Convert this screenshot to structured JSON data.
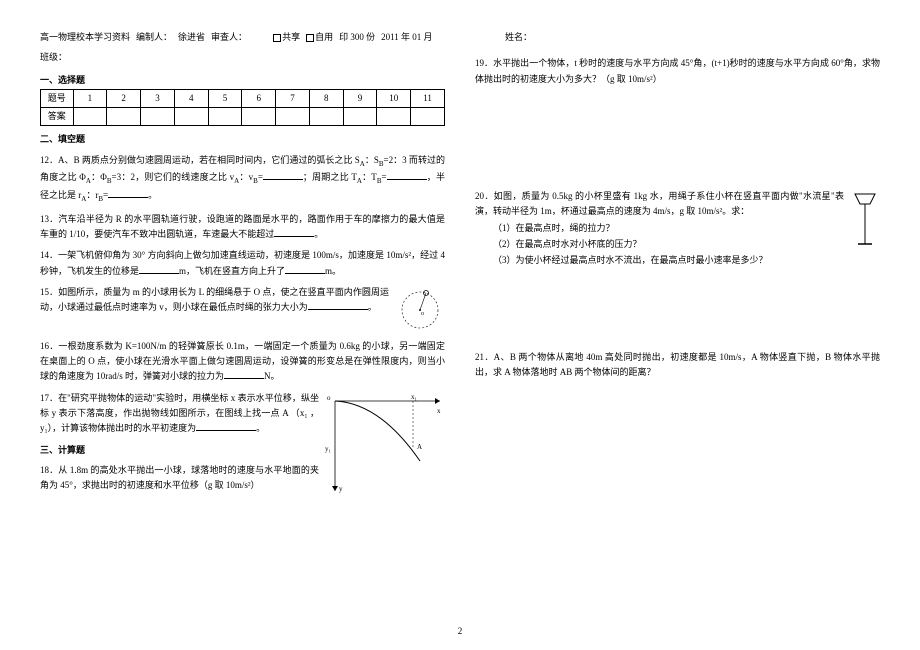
{
  "header": {
    "title": "高一物理校本学习资料",
    "author_label": "编制人：",
    "author": "徐进省",
    "reviewer_label": "审查人：",
    "share": "共享",
    "self": "自用",
    "print": "印 300 份",
    "date": "2011 年 01 月",
    "class_label": "班级：",
    "name_label": "姓名："
  },
  "section1": {
    "title": "一、选择题",
    "row1_label": "题号",
    "cols": [
      "1",
      "2",
      "3",
      "4",
      "5",
      "6",
      "7",
      "8",
      "9",
      "10",
      "11"
    ],
    "row2_label": "答案"
  },
  "section2_title": "二、填空题",
  "q12": "12．A、B 两质点分别做匀速圆周运动，若在相同时间内，它们通过的弧长之比 S",
  "q12b": "=2：3 而转过的角度之比 Φ",
  "q12c": "=3：2，则它们的线速度之比 v",
  "q12d": "；周期之比 T",
  "q12e": "，半径之比是 r",
  "q12f": "。",
  "q13": "13．汽车沿半径为 R 的水平圆轨道行驶，设跑道的路面是水平的，路面作用于车的摩擦力的最大值是车重的 1/10，要使汽车不致冲出圆轨道，车速最大不能超过",
  "q13b": "。",
  "q14": "14．一架飞机俯仰角为 30° 方向斜向上做匀加速直线运动，初速度是 100m/s，加速度是 10m/s²，经过 4 秒钟，飞机发生的位移是",
  "q14b": "m，飞机在竖直方向上升了",
  "q14c": "m。",
  "q15": "15．如图所示，质量为 m 的小球用长为 L 的细绳悬于 O 点，使之在竖直平面内作圆周运动，小球通过最低点时速率为 v，则小球在最低点时绳的张力大小为",
  "q15b": "。",
  "q16": "16．一根劲度系数为 K=100N/m 的轻弹簧原长 0.1m，一端固定一个质量为 0.6kg 的小球，另一端固定在桌面上的 O 点，使小球在光滑水平面上做匀速圆周运动，设弹簧的形变总是在弹性限度内，则当小球的角速度为 10rad/s 时，弹簧对小球的拉力为",
  "q16b": "N。",
  "q17": "17．在\"研究平抛物体的运动\"实验时，用横坐标 x 表示水平位移，纵坐标 y 表示下落高度，作出抛物线如图所示，在图线上找一点 A （x₁ ，y₁），计算该物体抛出时的水平初速度为",
  "q17b": "。",
  "section3_title": "三、计算题",
  "q18": "18．从 1.8m 的高处水平抛出一小球，球落地时的速度与水平地面的夹角为 45°，求抛出时的初速度和水平位移（g 取 10m/s²）",
  "q19": "19．水平抛出一个物体，t 秒时的速度与水平方向成 45°角，(t+1)秒时的速度与水平方向成 60°角，求物体抛出时的初速度大小为多大？（g 取 10m/s²）",
  "q20": "20．如图，质量为 0.5kg 的小杯里盛有 1kg 水，用绳子系住小杯在竖直平面内做\"水流星\"表演，转动半径为 1m，杯通过最高点的速度为 4m/s，g 取 10m/s²。求：",
  "q20_1": "（1）在最高点时，绳的拉力？",
  "q20_2": "（2）在最高点时水对小杯底的压力？",
  "q20_3": "（3）为使小杯经过最高点时水不流出，在最高点时最小速率是多少？",
  "q21": "21．A、B 两个物体从离地 40m 高处同时抛出，初速度都是 10m/s，A 物体竖直下抛，B 物体水平抛出，求 A 物体落地时 AB 两个物体间的距离？",
  "graph_labels": {
    "o": "o",
    "x": "x",
    "y": "y",
    "a": "A",
    "x1": "x₁",
    "y1": "y₁"
  },
  "page_number": "2"
}
